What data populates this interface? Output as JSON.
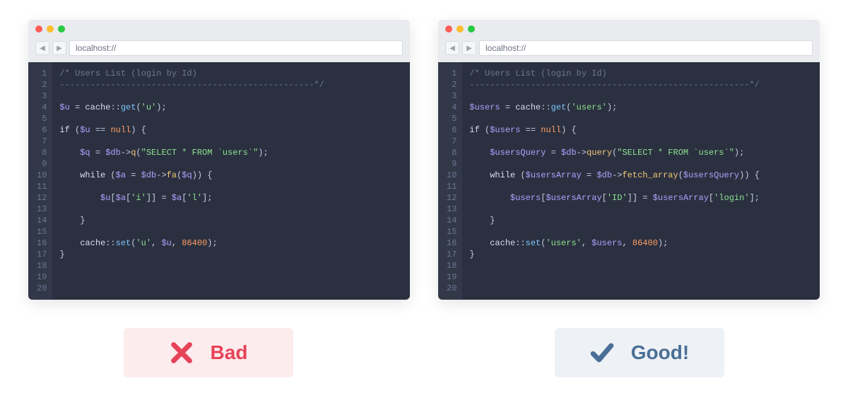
{
  "url": "localhost://",
  "lineCount": 20,
  "bad": {
    "lines": [
      [
        [
          "cmt",
          "/* Users List (login by Id)"
        ]
      ],
      [
        [
          "cmt",
          "--------------------------------------------------*/"
        ]
      ],
      [
        [
          "",
          ""
        ]
      ],
      [
        [
          "var",
          "$u"
        ],
        [
          "op",
          " = "
        ],
        [
          "cls",
          "cache"
        ],
        [
          "op",
          "::"
        ],
        [
          "fn",
          "get"
        ],
        [
          "paren",
          "("
        ],
        [
          "str",
          "'u'"
        ],
        [
          "paren",
          ")"
        ],
        [
          "op",
          ";"
        ]
      ],
      [
        [
          "",
          ""
        ]
      ],
      [
        [
          "kw",
          "if"
        ],
        [
          "op",
          " ("
        ],
        [
          "var",
          "$u"
        ],
        [
          "op",
          " == "
        ],
        [
          "null",
          "null"
        ],
        [
          "op",
          ") "
        ],
        [
          "brace",
          "{"
        ]
      ],
      [
        [
          "",
          ""
        ]
      ],
      [
        [
          "op",
          "    "
        ],
        [
          "var",
          "$q"
        ],
        [
          "op",
          " = "
        ],
        [
          "var",
          "$db"
        ],
        [
          "op",
          "->"
        ],
        [
          "fn2",
          "q"
        ],
        [
          "paren",
          "("
        ],
        [
          "str",
          "\"SELECT * FROM `users`\""
        ],
        [
          "paren",
          ")"
        ],
        [
          "op",
          ";"
        ]
      ],
      [
        [
          "",
          ""
        ]
      ],
      [
        [
          "op",
          "    "
        ],
        [
          "kw",
          "while"
        ],
        [
          "op",
          " ("
        ],
        [
          "var",
          "$a"
        ],
        [
          "op",
          " = "
        ],
        [
          "var",
          "$db"
        ],
        [
          "op",
          "->"
        ],
        [
          "fn2",
          "fa"
        ],
        [
          "paren",
          "("
        ],
        [
          "var",
          "$q"
        ],
        [
          "paren",
          ")"
        ],
        [
          "op",
          ") "
        ],
        [
          "brace",
          "{"
        ]
      ],
      [
        [
          "",
          ""
        ]
      ],
      [
        [
          "op",
          "        "
        ],
        [
          "var",
          "$u"
        ],
        [
          "op",
          "["
        ],
        [
          "var",
          "$a"
        ],
        [
          "op",
          "["
        ],
        [
          "str",
          "'i'"
        ],
        [
          "op",
          "]] = "
        ],
        [
          "var",
          "$a"
        ],
        [
          "op",
          "["
        ],
        [
          "str",
          "'l'"
        ],
        [
          "op",
          "];"
        ]
      ],
      [
        [
          "",
          ""
        ]
      ],
      [
        [
          "op",
          "    "
        ],
        [
          "brace",
          "}"
        ]
      ],
      [
        [
          "",
          ""
        ]
      ],
      [
        [
          "op",
          "    "
        ],
        [
          "cls",
          "cache"
        ],
        [
          "op",
          "::"
        ],
        [
          "fn",
          "set"
        ],
        [
          "paren",
          "("
        ],
        [
          "str",
          "'u'"
        ],
        [
          "op",
          ", "
        ],
        [
          "var",
          "$u"
        ],
        [
          "op",
          ", "
        ],
        [
          "num",
          "86400"
        ],
        [
          "paren",
          ")"
        ],
        [
          "op",
          ";"
        ]
      ],
      [
        [
          "brace",
          "}"
        ]
      ],
      [
        [
          "",
          ""
        ]
      ],
      [
        [
          "",
          ""
        ]
      ],
      [
        [
          "",
          ""
        ]
      ]
    ]
  },
  "good": {
    "lines": [
      [
        [
          "cmt",
          "/* Users List (login by Id)"
        ]
      ],
      [
        [
          "cmt",
          "-------------------------------------------------------*/"
        ]
      ],
      [
        [
          "",
          ""
        ]
      ],
      [
        [
          "var",
          "$users"
        ],
        [
          "op",
          " = "
        ],
        [
          "cls",
          "cache"
        ],
        [
          "op",
          "::"
        ],
        [
          "fn",
          "get"
        ],
        [
          "paren",
          "("
        ],
        [
          "str",
          "'users'"
        ],
        [
          "paren",
          ")"
        ],
        [
          "op",
          ";"
        ]
      ],
      [
        [
          "",
          ""
        ]
      ],
      [
        [
          "kw",
          "if"
        ],
        [
          "op",
          " ("
        ],
        [
          "var",
          "$users"
        ],
        [
          "op",
          " == "
        ],
        [
          "null",
          "null"
        ],
        [
          "op",
          ") "
        ],
        [
          "brace",
          "{"
        ]
      ],
      [
        [
          "",
          ""
        ]
      ],
      [
        [
          "op",
          "    "
        ],
        [
          "var",
          "$usersQuery"
        ],
        [
          "op",
          " = "
        ],
        [
          "var",
          "$db"
        ],
        [
          "op",
          "->"
        ],
        [
          "fn2",
          "query"
        ],
        [
          "paren",
          "("
        ],
        [
          "str",
          "\"SELECT * FROM `users`\""
        ],
        [
          "paren",
          ")"
        ],
        [
          "op",
          ";"
        ]
      ],
      [
        [
          "",
          ""
        ]
      ],
      [
        [
          "op",
          "    "
        ],
        [
          "kw",
          "while"
        ],
        [
          "op",
          " ("
        ],
        [
          "var",
          "$usersArray"
        ],
        [
          "op",
          " = "
        ],
        [
          "var",
          "$db"
        ],
        [
          "op",
          "->"
        ],
        [
          "fn2",
          "fetch_array"
        ],
        [
          "paren",
          "("
        ],
        [
          "var",
          "$usersQuery"
        ],
        [
          "paren",
          ")"
        ],
        [
          "op",
          ") "
        ],
        [
          "brace",
          "{"
        ]
      ],
      [
        [
          "",
          ""
        ]
      ],
      [
        [
          "op",
          "        "
        ],
        [
          "var",
          "$users"
        ],
        [
          "op",
          "["
        ],
        [
          "var",
          "$usersArray"
        ],
        [
          "op",
          "["
        ],
        [
          "str",
          "'ID'"
        ],
        [
          "op",
          "]] = "
        ],
        [
          "var",
          "$usersArray"
        ],
        [
          "op",
          "["
        ],
        [
          "str",
          "'login'"
        ],
        [
          "op",
          "];"
        ]
      ],
      [
        [
          "",
          ""
        ]
      ],
      [
        [
          "op",
          "    "
        ],
        [
          "brace",
          "}"
        ]
      ],
      [
        [
          "",
          ""
        ]
      ],
      [
        [
          "op",
          "    "
        ],
        [
          "cls",
          "cache"
        ],
        [
          "op",
          "::"
        ],
        [
          "fn",
          "set"
        ],
        [
          "paren",
          "("
        ],
        [
          "str",
          "'users'"
        ],
        [
          "op",
          ", "
        ],
        [
          "var",
          "$users"
        ],
        [
          "op",
          ", "
        ],
        [
          "num",
          "86400"
        ],
        [
          "paren",
          ")"
        ],
        [
          "op",
          ";"
        ]
      ],
      [
        [
          "brace",
          "}"
        ]
      ],
      [
        [
          "",
          ""
        ]
      ],
      [
        [
          "",
          ""
        ]
      ],
      [
        [
          "",
          ""
        ]
      ]
    ]
  },
  "badges": {
    "bad": "Bad",
    "good": "Good!"
  }
}
